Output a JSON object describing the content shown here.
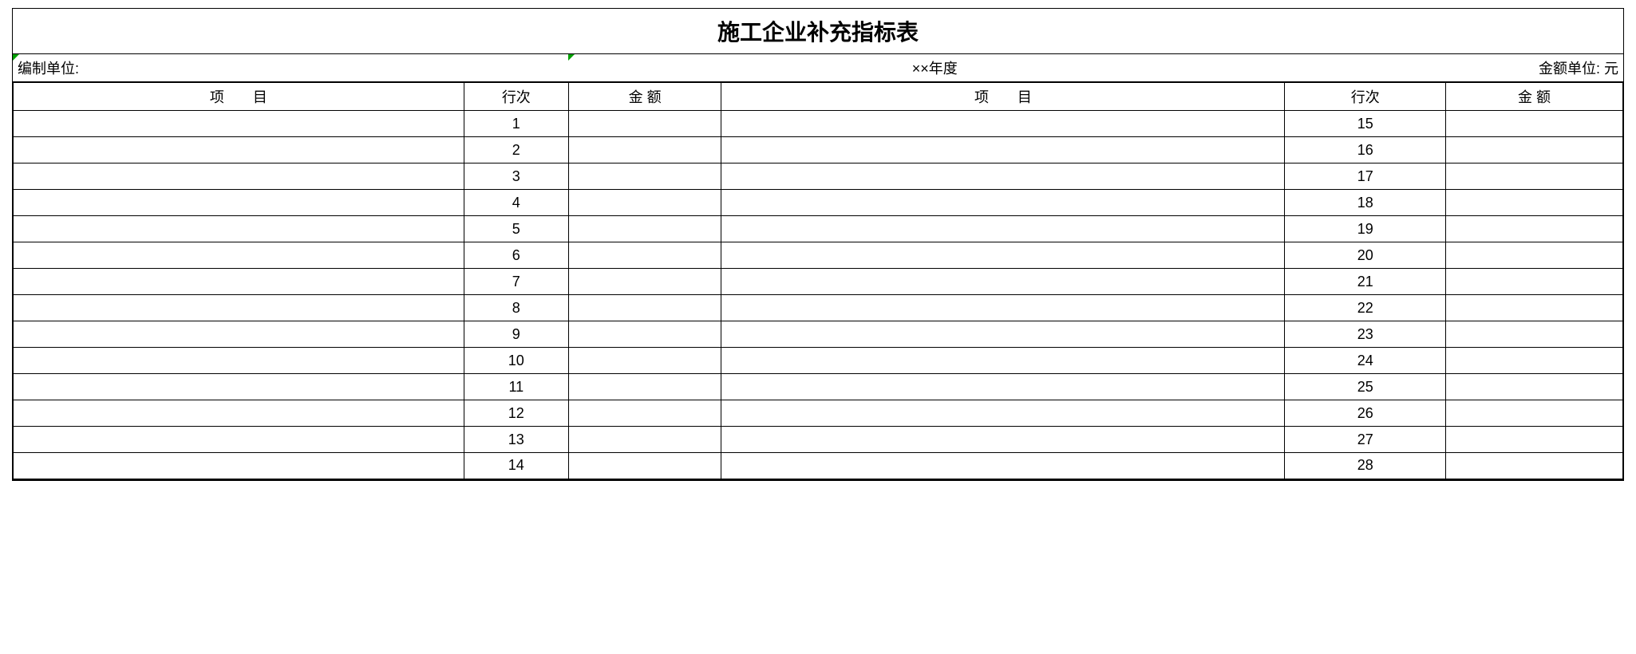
{
  "title": "施工企业补充指标表",
  "info": {
    "unit_label": "编制单位:",
    "period": "××年度",
    "currency_label": "金额单位: 元"
  },
  "headers": {
    "item": "项　　目",
    "line": "行次",
    "amount": "金  额"
  },
  "rows_left": [
    {
      "item": "",
      "line": "1",
      "amount": ""
    },
    {
      "item": "",
      "line": "2",
      "amount": ""
    },
    {
      "item": "",
      "line": "3",
      "amount": ""
    },
    {
      "item": "",
      "line": "4",
      "amount": ""
    },
    {
      "item": "",
      "line": "5",
      "amount": ""
    },
    {
      "item": "",
      "line": "6",
      "amount": ""
    },
    {
      "item": "",
      "line": "7",
      "amount": ""
    },
    {
      "item": "",
      "line": "8",
      "amount": ""
    },
    {
      "item": "",
      "line": "9",
      "amount": ""
    },
    {
      "item": "",
      "line": "10",
      "amount": ""
    },
    {
      "item": "",
      "line": "11",
      "amount": ""
    },
    {
      "item": "",
      "line": "12",
      "amount": ""
    },
    {
      "item": "",
      "line": "13",
      "amount": ""
    },
    {
      "item": "",
      "line": "14",
      "amount": ""
    }
  ],
  "rows_right": [
    {
      "item": "",
      "line": "15",
      "amount": ""
    },
    {
      "item": "",
      "line": "16",
      "amount": ""
    },
    {
      "item": "",
      "line": "17",
      "amount": ""
    },
    {
      "item": "",
      "line": "18",
      "amount": ""
    },
    {
      "item": "",
      "line": "19",
      "amount": ""
    },
    {
      "item": "",
      "line": "20",
      "amount": ""
    },
    {
      "item": "",
      "line": "21",
      "amount": ""
    },
    {
      "item": "",
      "line": "22",
      "amount": ""
    },
    {
      "item": "",
      "line": "23",
      "amount": ""
    },
    {
      "item": "",
      "line": "24",
      "amount": ""
    },
    {
      "item": "",
      "line": "25",
      "amount": ""
    },
    {
      "item": "",
      "line": "26",
      "amount": ""
    },
    {
      "item": "",
      "line": "27",
      "amount": ""
    },
    {
      "item": "",
      "line": "28",
      "amount": ""
    }
  ]
}
